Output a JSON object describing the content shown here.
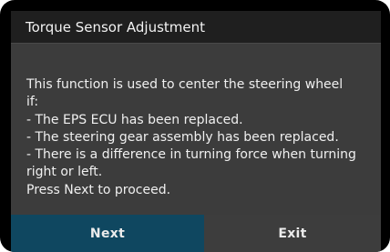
{
  "dialog": {
    "title": "Torque Sensor Adjustment",
    "message_lines": [
      "This function is used to center the steering wheel",
      "if:",
      "- The EPS ECU has been replaced.",
      "- The steering gear assembly has been replaced.",
      "- There is a difference in turning force when turning",
      "right or left.",
      "Press Next to proceed."
    ]
  },
  "buttons": {
    "next_label": "Next",
    "exit_label": "Exit"
  },
  "colors": {
    "title_bar": "#1f1f1f",
    "dialog_body": "#3c3c3c",
    "next_button": "#0f4760",
    "exit_button": "#3d3d3d",
    "frame": "#000000"
  }
}
